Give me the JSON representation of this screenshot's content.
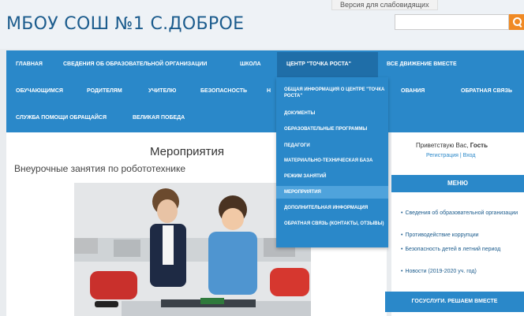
{
  "header": {
    "site_title": "МБОУ СОШ №1 С.ДОБРОЕ",
    "vision_link": "Версия для слабовидящих",
    "search_placeholder": ""
  },
  "nav": {
    "row1": [
      "Главная",
      "Сведения об образовательной организации",
      "Школа",
      "Центр \"Точка роста\"",
      "Все движение вместе"
    ],
    "row2": [
      "Обучающимся",
      "Родителям",
      "Учителю",
      "Безопасность",
      "Н",
      "ОВАНИЯ",
      "Обратная связь"
    ],
    "row3": [
      "Служба помощи обращайся",
      "Великая Победа"
    ]
  },
  "dropdown": {
    "items": [
      "Общая информация о Центре \"Точка роста\"",
      "Документы",
      "Образовательные программы",
      "Педагоги",
      "Материально-техническая база",
      "Режим занятий",
      "Мероприятия",
      "Дополнительная информация",
      "Обратная связь (контакты, отзывы)"
    ],
    "active_index": 6
  },
  "main": {
    "heading": "Мероприятия",
    "article_title": "Внеурочные занятия по робототехнике"
  },
  "sidebar": {
    "greeting_prefix": "Приветствую Вас,",
    "greeting_name": "Гость",
    "links_line": "Регистрация | Вход",
    "menu_title": "МЕНЮ",
    "links": [
      "Сведения об образовательной организации",
      "Противодействие коррупции",
      "Безопасность детей в летний период",
      "Новости (2019-2020 уч. год)"
    ],
    "banner": "ГОСУСЛУГИ. РЕШАЕМ ВМЕСТЕ"
  },
  "colors": {
    "nav_blue": "#2a88c9",
    "title_blue": "#1c5c8d",
    "search_orange": "#f08a24"
  },
  "icons": {
    "search": "magnifier-icon"
  }
}
